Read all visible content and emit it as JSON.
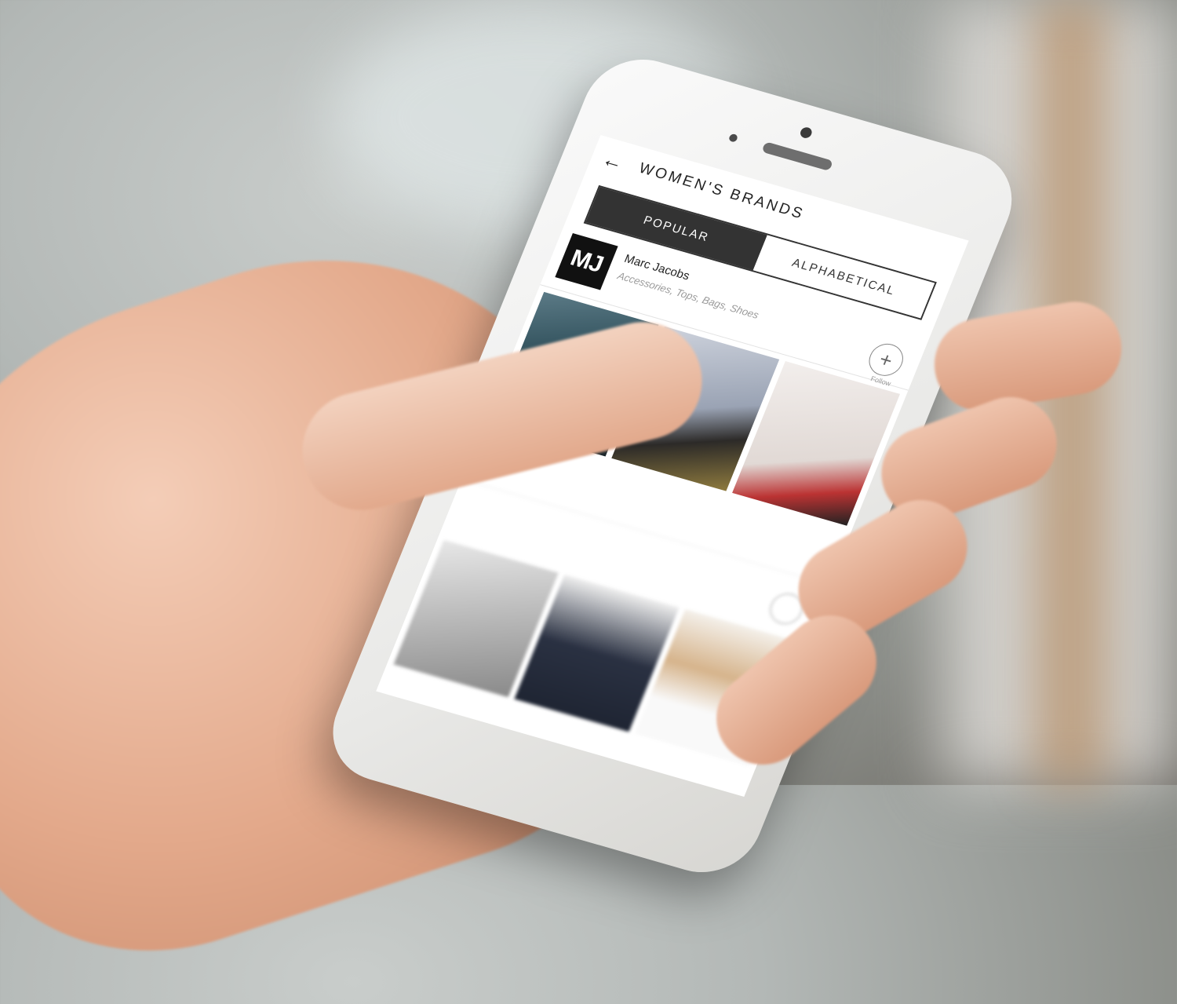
{
  "header": {
    "title": "WOMEN'S BRANDS",
    "back_icon": "arrow-left-icon"
  },
  "tabs": [
    {
      "label": "POPULAR",
      "active": true
    },
    {
      "label": "ALPHABETICAL",
      "active": false
    }
  ],
  "brand": {
    "logo_text": "MJ",
    "name": "Marc Jacobs",
    "categories": "Accessories, Tops, Bags, Shoes",
    "follow_symbol": "+",
    "follow_label": "Follow"
  },
  "colors": {
    "tab_active_bg": "#333333",
    "tab_active_text": "#ffffff",
    "logo_bg": "#111111"
  }
}
